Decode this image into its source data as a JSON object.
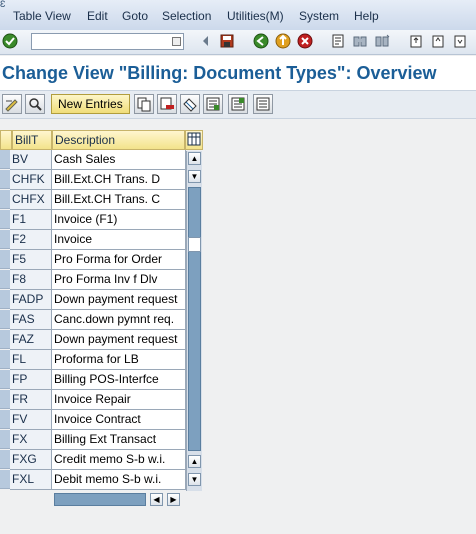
{
  "menubar": {
    "corner_icon": "sap-window-icon",
    "items": [
      {
        "label": "Table View"
      },
      {
        "label": "Edit"
      },
      {
        "label": "Goto"
      },
      {
        "label": "Selection"
      },
      {
        "label": "Utilities(M)"
      },
      {
        "label": "System"
      },
      {
        "label": "Help"
      }
    ]
  },
  "toolbar": {
    "command_field": {
      "value": "",
      "placeholder": ""
    },
    "icons": [
      "enter-icon",
      "back-icon",
      "save-icon",
      "green-back-icon",
      "exit-icon",
      "cancel-icon",
      "print-icon",
      "find-icon",
      "find-next-icon",
      "first-page-icon",
      "previous-page-icon",
      "next-page-icon"
    ]
  },
  "title": "Change View \"Billing: Document Types\": Overview",
  "app_toolbar": {
    "new_entries_label": "New Entries",
    "icons": [
      "display-change-icon",
      "details-icon",
      "copy-as-icon",
      "delete-icon",
      "undo-change-icon",
      "select-all-icon",
      "select-block-icon",
      "deselect-all-icon"
    ]
  },
  "table": {
    "columns": [
      "BillT",
      "Description"
    ],
    "rows": [
      {
        "billt": "BV",
        "description": "Cash Sales"
      },
      {
        "billt": "CHFK",
        "description": "Bill.Ext.CH Trans. D"
      },
      {
        "billt": "CHFX",
        "description": "Bill.Ext.CH Trans. C"
      },
      {
        "billt": "F1",
        "description": "Invoice (F1)"
      },
      {
        "billt": "F2",
        "description": "Invoice"
      },
      {
        "billt": "F5",
        "description": "Pro Forma for Order"
      },
      {
        "billt": "F8",
        "description": "Pro Forma Inv f Dlv"
      },
      {
        "billt": "FADP",
        "description": "Down payment request"
      },
      {
        "billt": "FAS",
        "description": "Canc.down pymnt req."
      },
      {
        "billt": "FAZ",
        "description": "Down payment request"
      },
      {
        "billt": "FL",
        "description": "Proforma for LB"
      },
      {
        "billt": "FP",
        "description": "Billing POS-Interfce"
      },
      {
        "billt": "FR",
        "description": "Invoice Repair"
      },
      {
        "billt": "FV",
        "description": "Invoice Contract"
      },
      {
        "billt": "FX",
        "description": "Billing Ext Transact"
      },
      {
        "billt": "FXG",
        "description": "Credit memo S-b w.i."
      },
      {
        "billt": "FXL",
        "description": "Debit memo S-b w.i."
      }
    ]
  },
  "colors": {
    "title": "#1b5e97",
    "header_bg": "#f3e38b",
    "new_entries_bg": "#f0dd7a",
    "scroll_track": "#7da0bf"
  }
}
